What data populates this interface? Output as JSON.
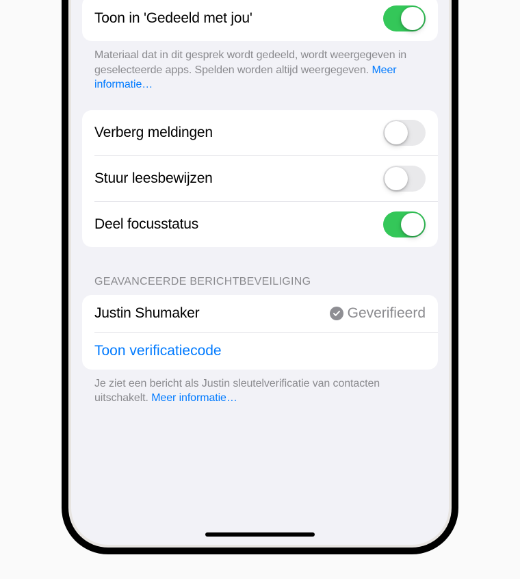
{
  "section1": {
    "toggle1": {
      "label": "Toon in 'Gedeeld met jou'",
      "on": true
    },
    "footer": {
      "text": "Materiaal dat in dit gesprek wordt gedeeld, wordt weergegeven in geselecteerde apps. Spelden worden altijd weergegeven. ",
      "link": "Meer informatie…"
    }
  },
  "section2": {
    "items": [
      {
        "label": "Verberg meldingen",
        "on": false
      },
      {
        "label": "Stuur leesbewijzen",
        "on": false
      },
      {
        "label": "Deel focusstatus",
        "on": true
      }
    ]
  },
  "section3": {
    "header": "GEAVANCEERDE BERICHTBEVEILIGING",
    "name": "Justin Shumaker",
    "status": "Geverifieerd",
    "action": "Toon verificatiecode",
    "footer": {
      "text": "Je ziet een bericht als Justin sleutelverificatie van contacten uitschakelt. ",
      "link": "Meer informatie…"
    }
  }
}
